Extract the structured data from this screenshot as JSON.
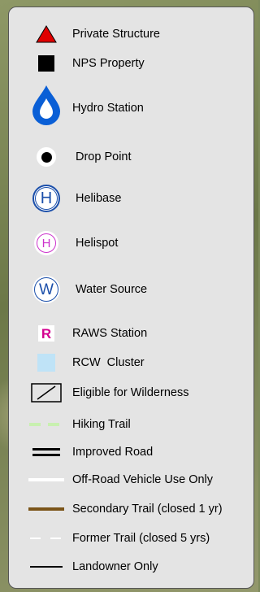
{
  "legend": {
    "items": [
      {
        "label": "Private Structure",
        "icon": "triangle-icon",
        "color": "#e00000"
      },
      {
        "label": "NPS Property",
        "icon": "square-icon",
        "color": "#000000"
      },
      {
        "label": "Hydro Station",
        "icon": "water-drop-icon",
        "color": "#0055cc"
      },
      {
        "label": "Drop Point",
        "icon": "dot-icon",
        "color": "#000000"
      },
      {
        "label": "Helibase",
        "icon": "helibase-icon",
        "symbol": "H",
        "color": "#1b4faa"
      },
      {
        "label": "Helispot",
        "icon": "helispot-icon",
        "symbol": "H",
        "color": "#cc33cc"
      },
      {
        "label": "Water Source",
        "icon": "water-source-icon",
        "symbol": "W",
        "color": "#1b4faa"
      },
      {
        "label": "RAWS Station",
        "icon": "raws-icon",
        "symbol": "R",
        "color": "#d4008f"
      },
      {
        "label": "RCW  Cluster",
        "icon": "rcw-square-icon",
        "color": "#bfe3f7"
      },
      {
        "label": "Eligible for Wilderness",
        "icon": "wilderness-box-icon",
        "color": "#000000"
      },
      {
        "label": "Hiking Trail",
        "icon": "dashed-line-icon",
        "color": "#c8f0b0"
      },
      {
        "label": "Improved Road",
        "icon": "double-line-icon",
        "color": "#000000"
      },
      {
        "label": "Off-Road Vehicle Use Only",
        "icon": "white-line-icon",
        "color": "#ffffff"
      },
      {
        "label": "Secondary Trail (closed 1 yr)",
        "icon": "brown-line-icon",
        "color": "#7a5418"
      },
      {
        "label": "Former Trail (closed 5 yrs)",
        "icon": "white-dashed-line-icon",
        "color": "#ffffff"
      },
      {
        "label": "Landowner Only",
        "icon": "black-line-icon",
        "color": "#000000"
      }
    ]
  }
}
